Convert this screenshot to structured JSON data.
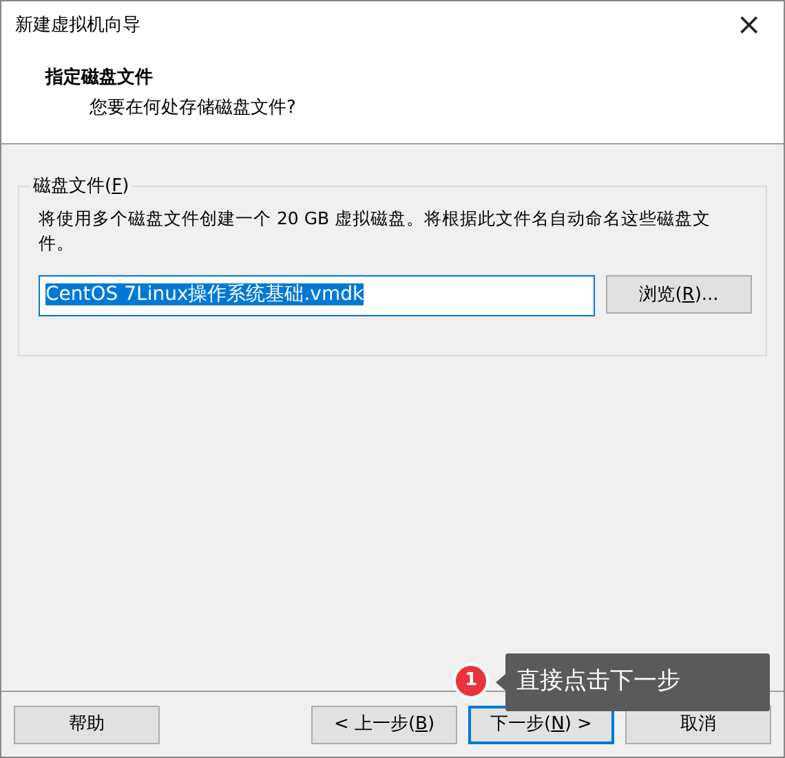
{
  "window": {
    "title": "新建虚拟机向导",
    "close": "×"
  },
  "header": {
    "title": "指定磁盘文件",
    "subtitle": "您要在何处存储磁盘文件?"
  },
  "group": {
    "label": {
      "before": "磁盘文件(",
      "access_key": "F",
      "after": ")"
    },
    "description": "将使用多个磁盘文件创建一个 20 GB 虚拟磁盘。将根据此文件名自动命名这些磁盘文件。",
    "file_field": {
      "value": "CentOS 7Linux操作系统基础.vmdk",
      "selected": true
    },
    "browse_button": {
      "label": {
        "before": "浏览(",
        "access_key": "R",
        "after": ")..."
      }
    }
  },
  "buttons": [
    {
      "label": {
        "before": "帮助"
      },
      "default": false
    },
    {
      "label": {
        "before": "< 上一步(",
        "access_key": "B",
        "after": ")"
      },
      "default": false
    },
    {
      "label": {
        "before": "下一步(",
        "access_key": "N",
        "after": ") >"
      },
      "default": true
    },
    {
      "label": {
        "before": "取消"
      },
      "default": false
    }
  ],
  "annotation": {
    "badge": "1",
    "text": "直接点击下一步"
  }
}
